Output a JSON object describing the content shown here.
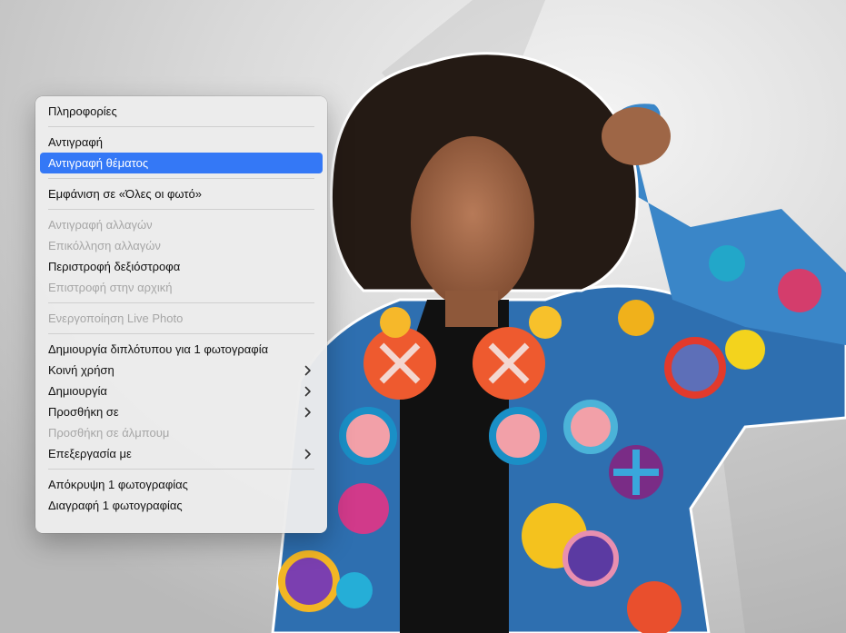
{
  "menu": {
    "items": [
      {
        "label": "Πληροφορίες"
      },
      {
        "label": "Αντιγραφή"
      },
      {
        "label": "Αντιγραφή θέματος"
      },
      {
        "label": "Εμφάνιση σε «Όλες οι φωτό»"
      },
      {
        "label": "Αντιγραφή αλλαγών"
      },
      {
        "label": "Επικόλληση αλλαγών"
      },
      {
        "label": "Περιστροφή δεξιόστροφα"
      },
      {
        "label": "Επιστροφή στην αρχική"
      },
      {
        "label": "Ενεργοποίηση Live Photo"
      },
      {
        "label": "Δημιουργία διπλότυπου για 1 φωτογραφία"
      },
      {
        "label": "Κοινή χρήση"
      },
      {
        "label": "Δημιουργία"
      },
      {
        "label": "Προσθήκη σε"
      },
      {
        "label": "Προσθήκη σε άλμπουμ"
      },
      {
        "label": "Επεξεργασία με"
      },
      {
        "label": "Απόκρυψη 1 φωτογραφίας"
      },
      {
        "label": "Διαγραφή 1 φωτογραφίας"
      }
    ]
  },
  "colors": {
    "selection": "#3478f6",
    "disabled_text": "#a6a6a6"
  }
}
